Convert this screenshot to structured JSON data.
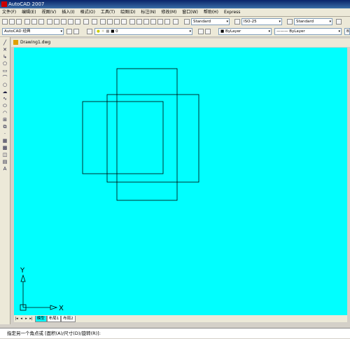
{
  "app": {
    "title": "AutoCAD 2007"
  },
  "menu": [
    "文件(F)",
    "编辑(E)",
    "视图(V)",
    "插入(I)",
    "格式(O)",
    "工具(T)",
    "绘图(D)",
    "标注(N)",
    "修改(M)",
    "窗口(W)",
    "帮助(H)",
    "Express"
  ],
  "styles": {
    "text_style": "Standard",
    "dim_style": "ISO-25",
    "table_style": "Standard"
  },
  "workspace": "AutoCAD 经典",
  "layer": "0",
  "properties": {
    "color": "ByLayer",
    "linetype": "ByLayer",
    "lineweight": "By"
  },
  "document": {
    "name": "Drawing1.dwg"
  },
  "tabs": [
    "模型",
    "布局1",
    "布局2"
  ],
  "ucs": {
    "x_label": "X",
    "y_label": "Y"
  },
  "command": {
    "prompt": "指定另一个角点或 [面积(A)/尺寸(D)/旋转(R)]:"
  },
  "colors": {
    "canvas": "#00ffff",
    "line": "#000000"
  }
}
